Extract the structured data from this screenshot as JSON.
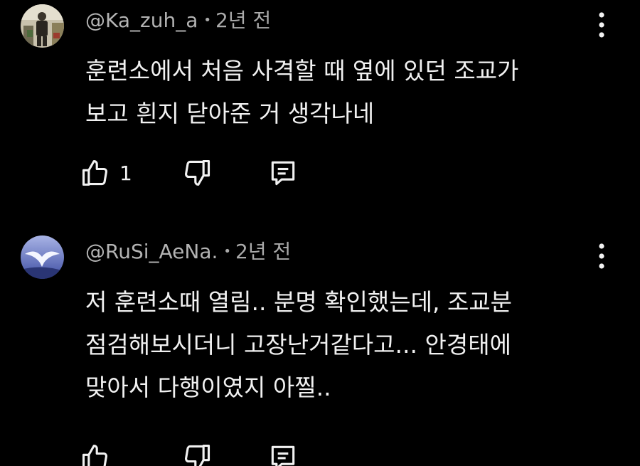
{
  "comments": [
    {
      "author": "@Ka_zuh_a",
      "separator": "•",
      "time": "2년 전",
      "text_lines": [
        "훈련소에서 처음 사격할 때 옆에 있던 조교가",
        "보고 흰지 닫아준 거 생각나네"
      ],
      "like_count": "1",
      "avatar_icon": "person-photo-avatar"
    },
    {
      "author": "@RuSi_AeNa.",
      "separator": "•",
      "time": "2년 전",
      "text_lines": [
        "저 훈련소때 열림.. 분명 확인했는데, 조교분",
        "점검해보시더니 고장난거같다고... 안경태에",
        "맞아서 다행이였지 아찔.."
      ],
      "like_count": "",
      "avatar_icon": "bird-avatar"
    }
  ],
  "icons": {
    "like": "thumbs-up-icon",
    "dislike": "thumbs-down-icon",
    "reply": "reply-comment-icon",
    "menu": "more-vertical-icon"
  },
  "colors": {
    "background": "#000000",
    "text": "#f1f1f1",
    "meta": "#aaaaaa"
  }
}
